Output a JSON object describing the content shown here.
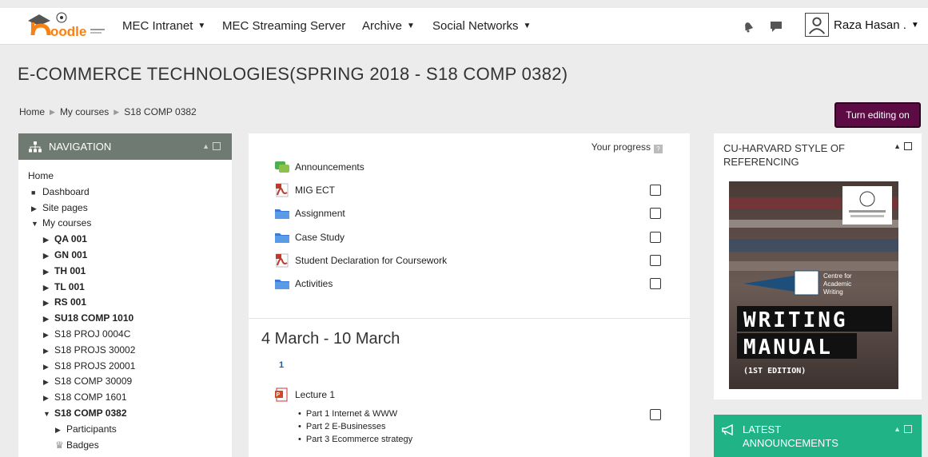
{
  "navbar": {
    "logo_text": "moodle",
    "items": [
      {
        "label": "MEC Intranet",
        "dropdown": true
      },
      {
        "label": "MEC Streaming Server",
        "dropdown": false
      },
      {
        "label": "Archive",
        "dropdown": true
      },
      {
        "label": "Social Networks",
        "dropdown": true
      }
    ],
    "icons": [
      "notifications-bell-icon",
      "messages-icon"
    ],
    "user_name": "Raza Hasan ."
  },
  "page": {
    "title": "E-COMMERCE TECHNOLOGIES(SPRING 2018 - S18 COMP 0382)",
    "breadcrumb": [
      "Home",
      "My courses",
      "S18 COMP 0382"
    ],
    "edit_button": "Turn editing on"
  },
  "navigation": {
    "title": "NAVIGATION",
    "items": [
      {
        "label": "Home",
        "marker": "none"
      },
      {
        "label": "Dashboard",
        "marker": "bullet"
      },
      {
        "label": "Site pages",
        "marker": "collapsed"
      },
      {
        "label": "My courses",
        "marker": "expanded"
      },
      {
        "label": "QA 001",
        "marker": "collapsed"
      },
      {
        "label": "GN 001",
        "marker": "collapsed"
      },
      {
        "label": "TH 001",
        "marker": "collapsed"
      },
      {
        "label": "TL 001",
        "marker": "collapsed"
      },
      {
        "label": "RS 001",
        "marker": "collapsed"
      },
      {
        "label": "SU18 COMP 1010",
        "marker": "collapsed"
      },
      {
        "label": "S18 PROJ 0004C",
        "marker": "collapsed"
      },
      {
        "label": "S18 PROJS 30002",
        "marker": "collapsed"
      },
      {
        "label": "S18 PROJS 20001",
        "marker": "collapsed"
      },
      {
        "label": "S18 COMP 30009",
        "marker": "collapsed"
      },
      {
        "label": "S18 COMP 1601",
        "marker": "collapsed"
      },
      {
        "label": "S18 COMP 0382",
        "marker": "expanded"
      },
      {
        "label": "Participants",
        "marker": "collapsed"
      },
      {
        "label": "Badges",
        "marker": "trophy"
      }
    ]
  },
  "course": {
    "progress_label": "Your progress",
    "activities": [
      {
        "label": "Announcements",
        "icon": "forum-icon",
        "checkbox": false
      },
      {
        "label": "MIG ECT",
        "icon": "pdf-icon",
        "checkbox": true
      },
      {
        "label": "Assignment",
        "icon": "folder-icon",
        "checkbox": true
      },
      {
        "label": "Case Study",
        "icon": "folder-icon",
        "checkbox": true
      },
      {
        "label": "Student Declaration for Coursework",
        "icon": "pdf-icon",
        "checkbox": true
      },
      {
        "label": "Activities",
        "icon": "folder-icon",
        "checkbox": true
      }
    ],
    "section": {
      "title": "4 March - 10 March",
      "number": "1",
      "lecture": "Lecture 1",
      "parts": [
        "Part 1 Internet & WWW",
        "Part 2 E-Businesses",
        "Part 3 Ecommerce strategy"
      ]
    }
  },
  "referencing": {
    "title": "CU-HARVARD STYLE OF REFERENCING",
    "book": {
      "centre": [
        "Centre for",
        "Academic",
        "Writing"
      ],
      "line1": "WRITING",
      "line2": "MANUAL",
      "edition": "(1ST EDITION)"
    }
  },
  "announcements": {
    "title": "LATEST ANNOUNCEMENTS"
  },
  "colors": {
    "nav_header": "#6f7a72",
    "edit_button": "#5c0b45",
    "announcements": "#1fb386",
    "moodle_orange": "#f98012"
  }
}
